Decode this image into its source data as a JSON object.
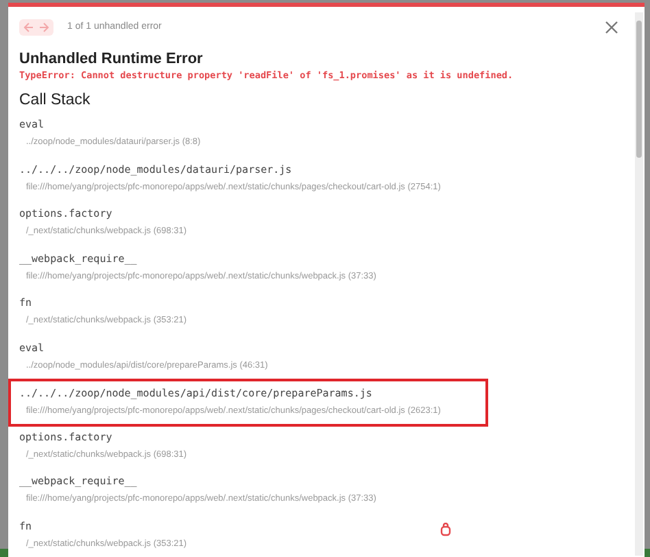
{
  "header": {
    "prev_disabled": true,
    "next_disabled": true,
    "counter": "1 of 1 unhandled error"
  },
  "title": "Unhandled Runtime Error",
  "message": "TypeError: Cannot destructure property 'readFile' of 'fs_1.promises' as it is undefined.",
  "call_stack": {
    "heading": "Call Stack",
    "frames": [
      {
        "function": "eval",
        "file": "../zoop/node_modules/datauri/parser.js (8:8)",
        "highlighted": false
      },
      {
        "function": "../../../zoop/node_modules/datauri/parser.js",
        "file": "file:///home/yang/projects/pfc-monorepo/apps/web/.next/static/chunks/pages/checkout/cart-old.js (2754:1)",
        "highlighted": false
      },
      {
        "function": "options.factory",
        "file": "/_next/static/chunks/webpack.js (698:31)",
        "highlighted": false
      },
      {
        "function": "__webpack_require__",
        "file": "file:///home/yang/projects/pfc-monorepo/apps/web/.next/static/chunks/webpack.js (37:33)",
        "highlighted": false
      },
      {
        "function": "fn",
        "file": "/_next/static/chunks/webpack.js (353:21)",
        "highlighted": false
      },
      {
        "function": "eval",
        "file": "../zoop/node_modules/api/dist/core/prepareParams.js (46:31)",
        "highlighted": false
      },
      {
        "function": "../../../zoop/node_modules/api/dist/core/prepareParams.js",
        "file": "file:///home/yang/projects/pfc-monorepo/apps/web/.next/static/chunks/pages/checkout/cart-old.js (2623:1)",
        "highlighted": true
      },
      {
        "function": "options.factory",
        "file": "/_next/static/chunks/webpack.js (698:31)",
        "highlighted": false
      },
      {
        "function": "__webpack_require__",
        "file": "file:///home/yang/projects/pfc-monorepo/apps/web/.next/static/chunks/webpack.js (37:33)",
        "highlighted": false
      },
      {
        "function": "fn",
        "file": "/_next/static/chunks/webpack.js (353:21)",
        "highlighted": false
      }
    ]
  }
}
